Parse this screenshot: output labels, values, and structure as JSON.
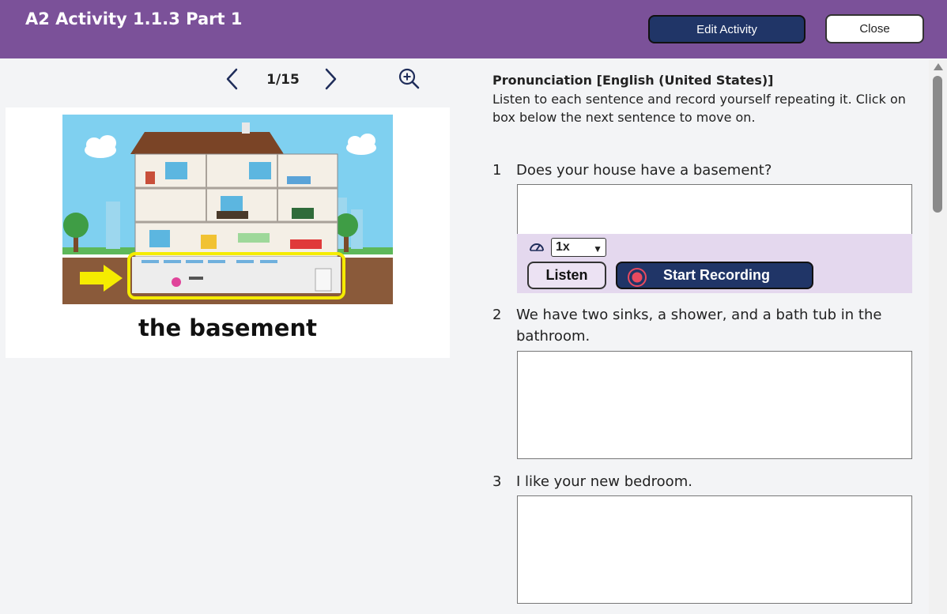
{
  "header": {
    "title": "A2 Activity 1.1.3 Part 1",
    "edit_label": "Edit Activity",
    "close_label": "Close"
  },
  "pager": {
    "page": "1/15",
    "icons": [
      "chevron-left-icon",
      "chevron-right-icon",
      "zoom-in-icon"
    ]
  },
  "image": {
    "caption": "the basement"
  },
  "instructions": {
    "title": "Pronunciation [English (United States)]",
    "text": "Listen to each sentence and record yourself repeating it. Click on box below the next sentence to move on."
  },
  "questions": [
    {
      "num": "1",
      "text": "Does your house have a basement?"
    },
    {
      "num": "2",
      "text": "We have two sinks, a shower, and a bath tub in the bathroom."
    },
    {
      "num": "3",
      "text": "I like your new bedroom."
    }
  ],
  "recorder": {
    "speed": "1x",
    "listen_label": "Listen",
    "record_label": "Start Recording"
  },
  "colors": {
    "header": "#7b5199",
    "primary_button": "#203567",
    "recorder_panel": "#e4d8ee",
    "record_dot": "#e84a5f"
  }
}
